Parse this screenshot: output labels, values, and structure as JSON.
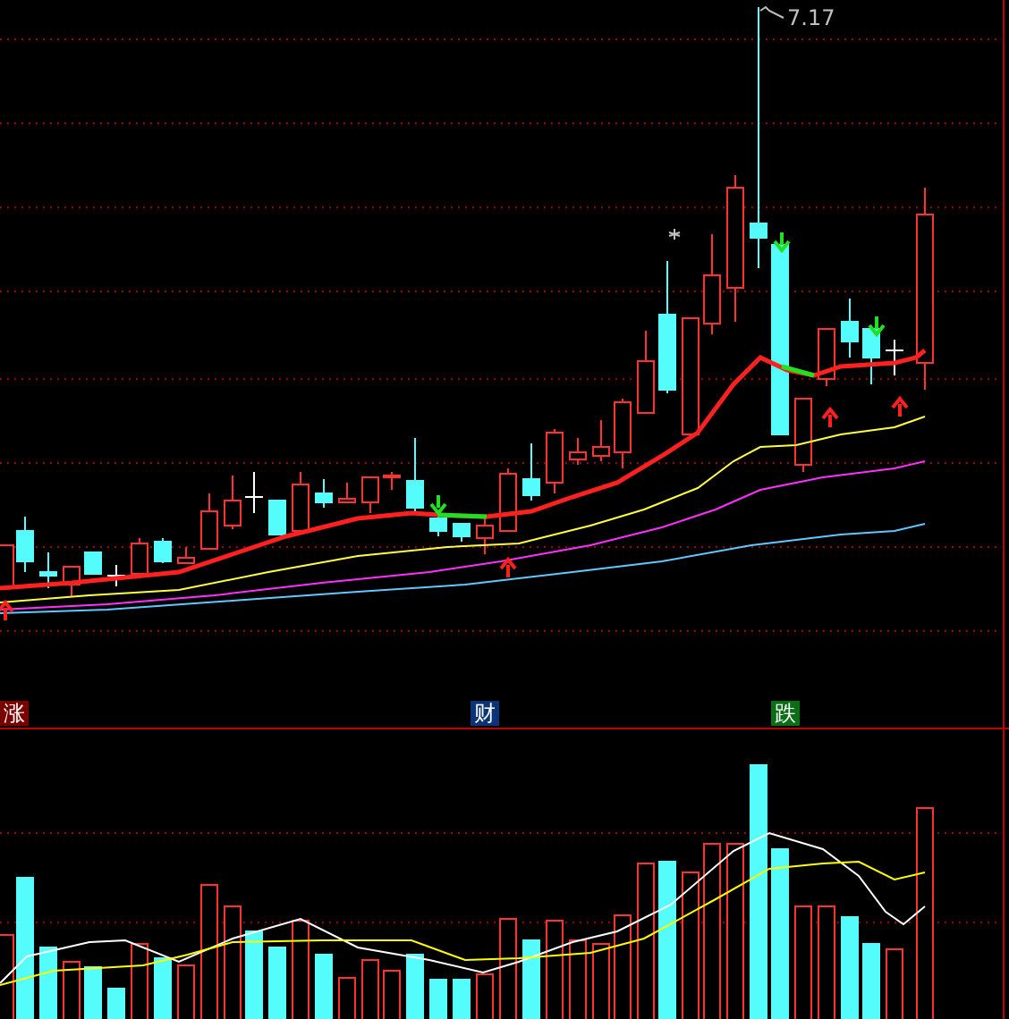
{
  "price_panel": {
    "high_label": "7.17",
    "signals": [
      {
        "label": "涨",
        "color": "#7a0000"
      },
      {
        "label": "财",
        "color": "#0a3378"
      },
      {
        "label": "跌",
        "color": "#0a6e14"
      }
    ]
  }
}
